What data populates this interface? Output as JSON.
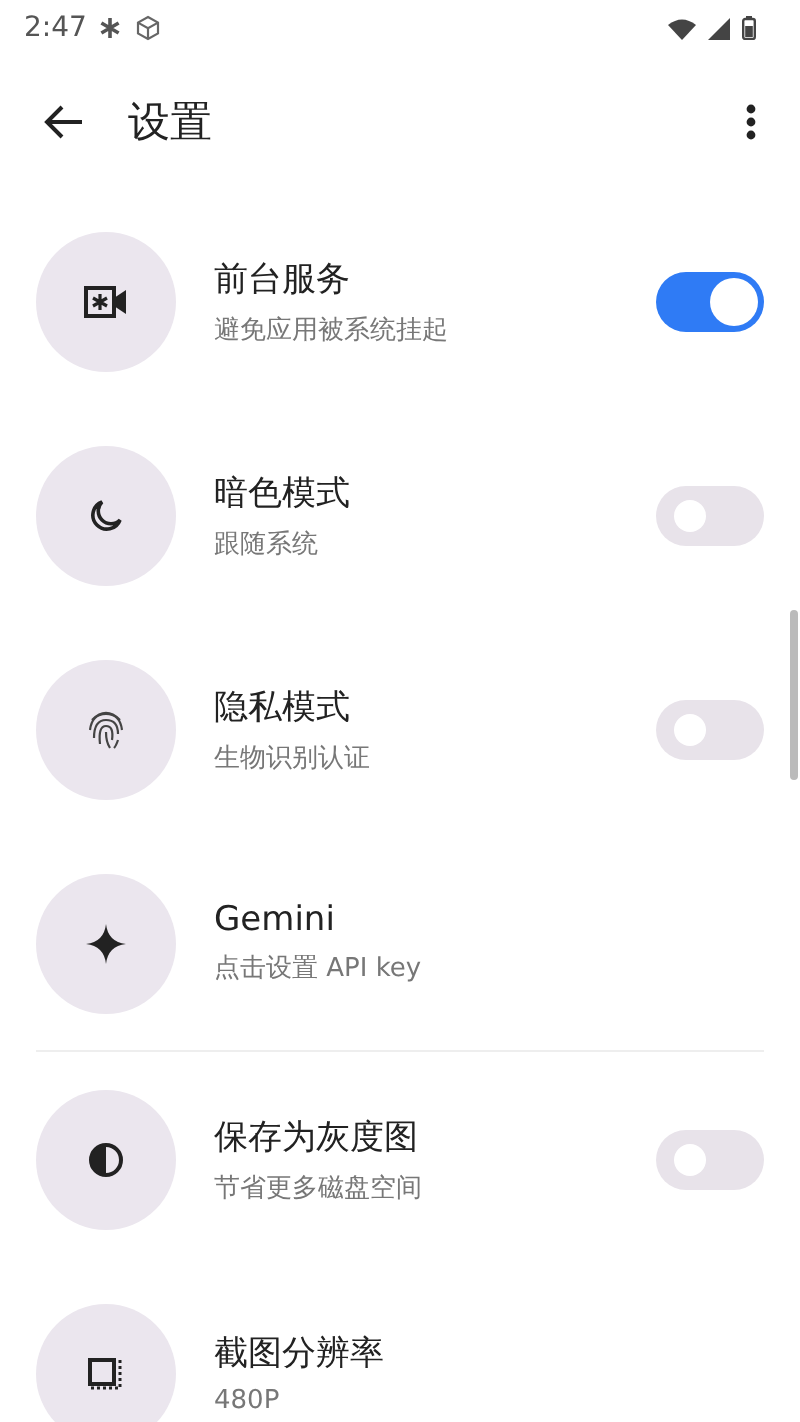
{
  "status_bar": {
    "time": "2:47"
  },
  "app_bar": {
    "title": "设置"
  },
  "settings": [
    {
      "kind": "toggle",
      "title": "前台服务",
      "subtitle": "避免应用被系统挂起",
      "on": true
    },
    {
      "kind": "toggle",
      "title": "暗色模式",
      "subtitle": "跟随系统",
      "on": false
    },
    {
      "kind": "toggle",
      "title": "隐私模式",
      "subtitle": "生物识别认证",
      "on": false
    },
    {
      "kind": "plain",
      "title": "Gemini",
      "subtitle": "点击设置 API key",
      "divider_after": true
    },
    {
      "kind": "toggle",
      "title": "保存为灰度图",
      "subtitle": "节省更多磁盘空间",
      "on": false
    },
    {
      "kind": "plain",
      "title": "截图分辨率",
      "subtitle": "480P"
    }
  ]
}
